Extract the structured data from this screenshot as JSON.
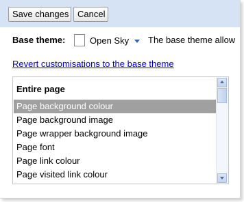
{
  "toolbar": {
    "save_label": "Save changes",
    "cancel_label": "Cancel",
    "background_color": "#d6e3f5"
  },
  "theme": {
    "label": "Base theme:",
    "selected": "Open Sky",
    "description": "The base theme allow"
  },
  "revert_link": "Revert customisations to the base theme",
  "list": {
    "header": "Entire page",
    "items": [
      {
        "label": "Page background colour",
        "selected": true
      },
      {
        "label": "Page background image",
        "selected": false
      },
      {
        "label": "Page wrapper background image",
        "selected": false
      },
      {
        "label": "Page font",
        "selected": false
      },
      {
        "label": "Page link colour",
        "selected": false
      },
      {
        "label": "Page visited link colour",
        "selected": false
      }
    ]
  },
  "colors": {
    "link": "#0000cc",
    "selected_row": "#a0a0a0"
  }
}
